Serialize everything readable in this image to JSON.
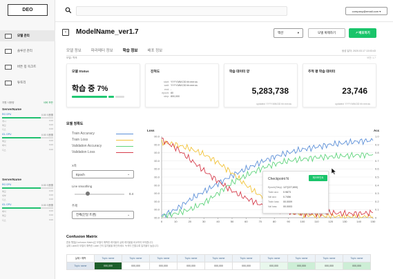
{
  "logo": "DEO",
  "sidebar": {
    "items": [
      {
        "label": "모델 관리",
        "active": true
      },
      {
        "label": "솔루션 관리",
        "active": false
      },
      {
        "label": "버튼 칭 옥크트",
        "active": false
      },
      {
        "label": "튜토리",
        "active": false
      }
    ],
    "usage_title": "자원 사용량",
    "usage_link": "서버 모든",
    "servers": [
      {
        "title": "ServerName",
        "gpus": [
          {
            "name": "RG GPU",
            "usage": "0.00 사용률",
            "fill": 0.75,
            "rows": [
              [
                "개시",
                "0.00"
              ],
              [
                "메모",
                "0.00"
              ],
              [
                "디스",
                "0.00"
              ]
            ]
          },
          {
            "name": "ICL GPU",
            "usage": "0.00 사용률",
            "fill": 0.75,
            "rows": [
              [
                "메모",
                "0.00"
              ],
              [
                "배치",
                "0.00"
              ],
              [
                "디스",
                "0.00"
              ]
            ]
          }
        ]
      },
      {
        "title": "ServerName",
        "gpus": [
          {
            "name": "RG GPU",
            "usage": "0.00 사용률",
            "fill": 0.75,
            "rows": [
              [
                "메모",
                "0.00"
              ],
              [
                "세부",
                "0.00"
              ],
              [
                "디스",
                "0.00"
              ]
            ]
          },
          {
            "name": "ICL GPU",
            "usage": "0.00 사용률",
            "fill": 0.75,
            "rows": [
              [
                "배치",
                "0.00"
              ],
              [
                "메모",
                "0.00"
              ],
              [
                "디스",
                "0.00"
              ]
            ]
          }
        ]
      }
    ]
  },
  "topbar": {
    "search_placeholder": "",
    "user": "company@email.com ▾"
  },
  "header": {
    "back": "‹",
    "title": "ModelName_ver1.7",
    "action_select": "액션",
    "action_caret": "▾",
    "copy_button": "모델 복제하기",
    "deploy_button": "↗ 배포하기"
  },
  "tabs": [
    {
      "label": "모델 정보",
      "active": false
    },
    {
      "label": "파라메터 정보",
      "active": false
    },
    {
      "label": "학습 정보",
      "active": true
    },
    {
      "label": "배포 정보",
      "active": false
    }
  ],
  "crumb": "모델 / 학포",
  "created": "생성 일자: 2020.03.17 13:03:43",
  "created_sub": "버전: 1.7",
  "cards": {
    "status": {
      "title": "모델 Status",
      "value": "학습 중 7%",
      "progress": 0.07
    },
    "progress": {
      "title": "진척도",
      "rows": [
        [
          "start:",
          "YYYY.MM.DD hh:mm:ss"
        ],
        [
          "wait:",
          "YYYY.MM.DD hh:mm:ss"
        ],
        [
          "end:",
          "-"
        ],
        [
          "epoch:",
          "80"
        ],
        [
          "step:",
          "800,000"
        ]
      ]
    },
    "train_data": {
      "title": "학습 데이터 양",
      "value": "5,283,738",
      "updated": "updated: YYYY.MM.DD hh:mm:ss"
    },
    "test_data": {
      "title": "추적 평 학습 데이터",
      "value": "23,746",
      "updated": "updated: YYYY.MM.DD hh:mm:ss"
    }
  },
  "graph_section": {
    "title": "모델 정확도",
    "legend": [
      {
        "label": "Train Accuracy",
        "color": "#5b8fd8"
      },
      {
        "label": "Train Loss",
        "color": "#f2c338"
      },
      {
        "label": "Validation Accuracy",
        "color": "#5fd47c"
      },
      {
        "label": "Validation Loss",
        "color": "#d63c4b"
      }
    ],
    "x_axis_label": "X축",
    "x_axis_value": "Epoch",
    "smoothing_label": "Line smoothing",
    "smoothing_value": "0.4",
    "smoothing_level": 0.25,
    "theme_label": "주제",
    "theme_value": "전체(단일 트랜)",
    "caret": "⌄"
  },
  "chart_data": {
    "type": "line",
    "left_axis_title": "Loss",
    "right_axis_title": "Acc",
    "xlim": [
      0,
      150
    ],
    "x_ticks": [
      "0",
      "10",
      "20",
      "30",
      "40",
      "50",
      "60",
      "70",
      "80",
      "90",
      "100",
      "110",
      "120",
      "130",
      "140",
      "150"
    ],
    "left_ticks": [
      "00.0",
      "00.0",
      "00.0",
      "00.0",
      "00.0",
      "00.0",
      "00.0",
      "00.0",
      "00.0",
      "00.0",
      "00.0"
    ],
    "right_ticks": [
      "1.0",
      "0.9",
      "0.8",
      "0.7",
      "0.6",
      "0.5",
      "0.4",
      "0.3",
      "0.2",
      "0.1",
      "0"
    ],
    "ylim": [
      0,
      1.0
    ],
    "series": [
      {
        "name": "Train Accuracy",
        "color": "#5b8fd8",
        "x": [
          0,
          10,
          20,
          30,
          40,
          50,
          60,
          70,
          80,
          90,
          100,
          110,
          120,
          130,
          140,
          150
        ],
        "y": [
          0.02,
          0.1,
          0.22,
          0.32,
          0.42,
          0.52,
          0.6,
          0.68,
          0.75,
          0.8,
          0.84,
          0.87,
          0.9,
          0.92,
          0.94,
          0.95
        ]
      },
      {
        "name": "Train Loss",
        "color": "#f2c338",
        "x": [
          0,
          10,
          20,
          30,
          40,
          50,
          60,
          70,
          80,
          90,
          100,
          110,
          120,
          130,
          140,
          150
        ],
        "y": [
          0.93,
          0.9,
          0.85,
          0.78,
          0.68,
          0.55,
          0.4,
          0.27,
          0.15,
          0.08,
          0.04,
          0.02,
          0.02,
          0.01,
          0.01,
          0.01
        ]
      },
      {
        "name": "Validation Accuracy",
        "color": "#5fd47c",
        "x": [
          0,
          10,
          20,
          30,
          40,
          50,
          60,
          70,
          80,
          90,
          100,
          110,
          120,
          130,
          140,
          150
        ],
        "y": [
          0.02,
          0.05,
          0.1,
          0.18,
          0.3,
          0.43,
          0.52,
          0.6,
          0.66,
          0.7,
          0.72,
          0.74,
          0.75,
          0.76,
          0.77,
          0.78
        ]
      },
      {
        "name": "Validation Loss",
        "color": "#d63c4b",
        "x": [
          0,
          10,
          20,
          30,
          40,
          50,
          60,
          70,
          80,
          90,
          100,
          110,
          120,
          130,
          140,
          150
        ],
        "y": [
          0.96,
          0.86,
          0.72,
          0.58,
          0.45,
          0.33,
          0.24,
          0.16,
          0.1,
          0.07,
          0.05,
          0.05,
          0.06,
          0.05,
          0.05,
          0.06
        ]
      }
    ]
  },
  "checkpoint": {
    "title": "Checkpoint N",
    "button": "체크포인트",
    "rows": [
      [
        "Epoch(Step):",
        "127(227,800)"
      ],
      [
        "Train acc:",
        "0.9873"
      ],
      [
        "Val acc:",
        "0.7456"
      ],
      [
        "Train loss:",
        "00.0009"
      ],
      [
        "Val loss:",
        "00.0003"
      ]
    ]
  },
  "confusion": {
    "title": "Confusion Matrix",
    "desc1": "혼동 행렬(Confusion Matrix)은 모델이 예측한 레이블과 실제 레이블을 비교하여 보여줍니다.",
    "desc2": "실제 Label과 모델이 예측한 Label 간의 일치율을 확인하세요. 녹색이 진할수록 일치율이 높습니다.",
    "corner": "실제 \\ 예측",
    "columns": [
      "Topic name",
      "Topic name",
      "Topic name",
      "Topic name",
      "Topic name",
      "Topic name",
      "Topic name",
      "Topic name",
      "Topic name",
      "Topic name"
    ],
    "rows": [
      {
        "label": "Topic name",
        "cells": [
          "000,000",
          "000,000",
          "000,000",
          "000,000",
          "000,000",
          "000,000",
          "000,000",
          "000,000",
          "000,000",
          "000,000"
        ]
      }
    ]
  }
}
